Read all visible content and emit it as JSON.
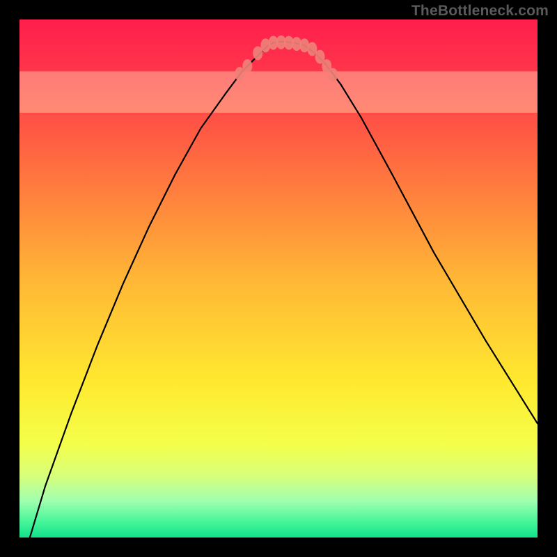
{
  "watermark": "TheBottleneck.com",
  "chart_data": {
    "type": "line",
    "title": "",
    "xlabel": "",
    "ylabel": "",
    "xlim": [
      0,
      100
    ],
    "ylim": [
      0,
      100
    ],
    "background": {
      "type": "vertical-gradient",
      "stops": [
        {
          "offset": 0.0,
          "color": "#ff1e4d"
        },
        {
          "offset": 0.12,
          "color": "#ff3a4a"
        },
        {
          "offset": 0.3,
          "color": "#ff743f"
        },
        {
          "offset": 0.5,
          "color": "#ffb636"
        },
        {
          "offset": 0.7,
          "color": "#ffe92f"
        },
        {
          "offset": 0.82,
          "color": "#f4ff4a"
        },
        {
          "offset": 0.88,
          "color": "#d8ff7a"
        },
        {
          "offset": 0.93,
          "color": "#9fffb0"
        },
        {
          "offset": 0.97,
          "color": "#45f59a"
        },
        {
          "offset": 1.0,
          "color": "#12e28b"
        }
      ]
    },
    "green_band": {
      "y_start": 92,
      "y_end": 100
    },
    "series": [
      {
        "name": "bottleneck-curve",
        "stroke": "#000000",
        "x": [
          2,
          5,
          10,
          15,
          20,
          25,
          30,
          35,
          40,
          43,
          46,
          48,
          49,
          50,
          51,
          53,
          55,
          57,
          59,
          62,
          66,
          72,
          80,
          90,
          100
        ],
        "y": [
          0,
          10,
          24,
          37,
          49,
          60,
          70,
          79,
          86,
          90,
          93,
          95,
          95.5,
          95.7,
          95.7,
          95.5,
          95,
          93.5,
          91.5,
          87.5,
          81,
          70,
          55,
          38,
          22
        ]
      }
    ],
    "markers": {
      "name": "intersection-markers",
      "color": "#f08078",
      "points": [
        {
          "x": 42.5,
          "y": 89.5
        },
        {
          "x": 44.0,
          "y": 91.0
        },
        {
          "x": 46.0,
          "y": 93.5
        },
        {
          "x": 47.5,
          "y": 95.0
        },
        {
          "x": 49.0,
          "y": 95.5
        },
        {
          "x": 50.5,
          "y": 95.6
        },
        {
          "x": 52.0,
          "y": 95.5
        },
        {
          "x": 53.5,
          "y": 95.3
        },
        {
          "x": 55.0,
          "y": 95.0
        },
        {
          "x": 56.5,
          "y": 94.3
        },
        {
          "x": 58.0,
          "y": 92.8
        },
        {
          "x": 59.3,
          "y": 91.0
        },
        {
          "x": 60.5,
          "y": 89.3
        }
      ]
    }
  }
}
